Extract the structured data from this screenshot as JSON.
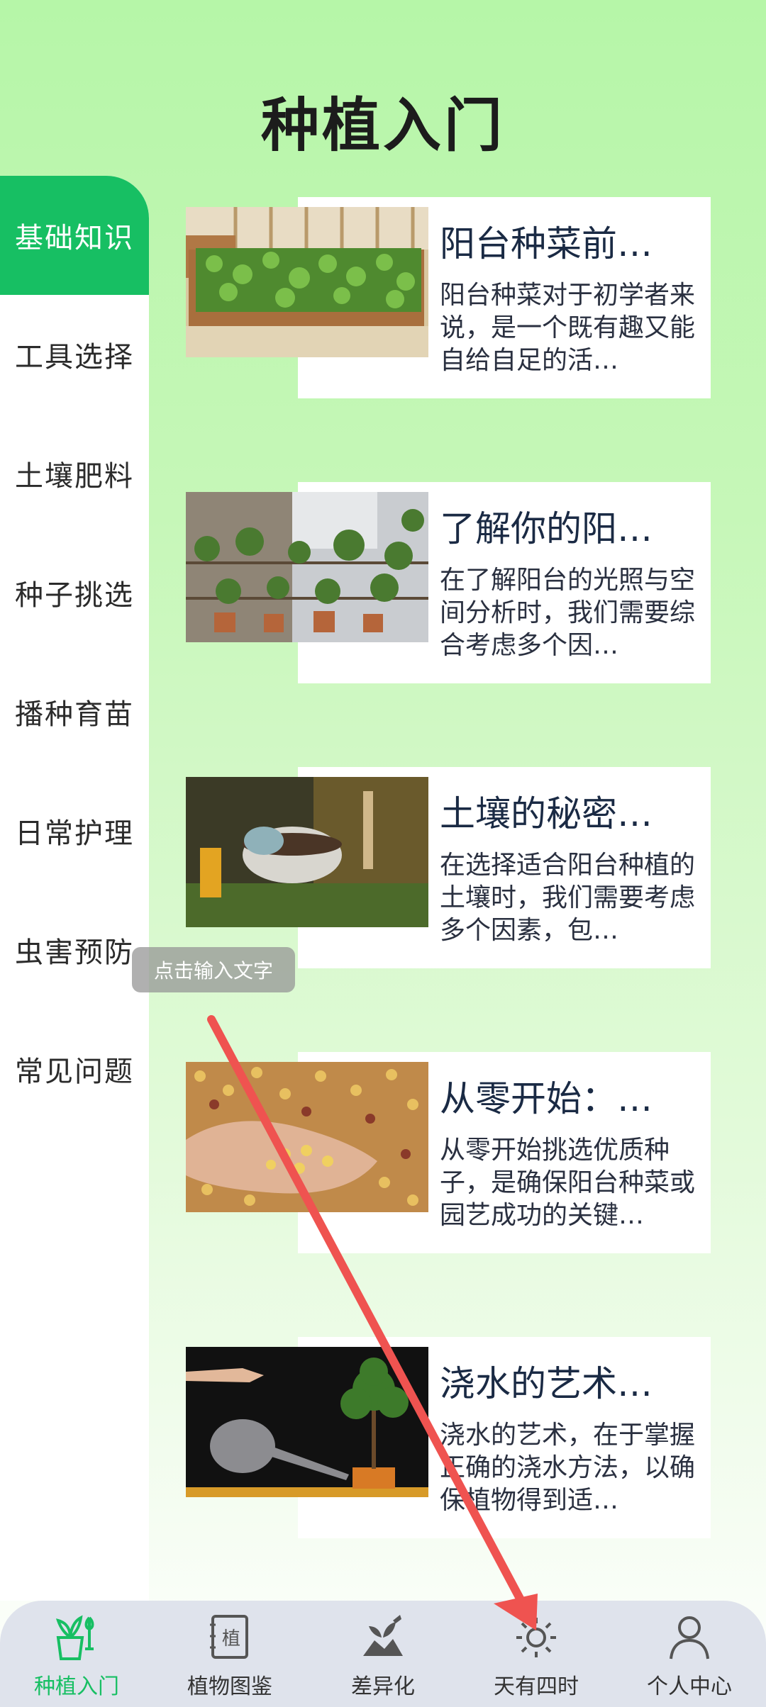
{
  "page": {
    "title": "种植入门"
  },
  "sidebar": {
    "items": [
      {
        "label": "基础知识",
        "active": true
      },
      {
        "label": "工具选择",
        "active": false
      },
      {
        "label": "土壤肥料",
        "active": false
      },
      {
        "label": "种子挑选",
        "active": false
      },
      {
        "label": "播种育苗",
        "active": false
      },
      {
        "label": "日常护理",
        "active": false
      },
      {
        "label": "虫害预防",
        "active": false
      },
      {
        "label": "常见问题",
        "active": false
      }
    ]
  },
  "articles": [
    {
      "title": "阳台种菜前…",
      "desc": "阳台种菜对于初学者来说，是一个既有趣又能自给自足的活…"
    },
    {
      "title": "了解你的阳…",
      "desc": "在了解阳台的光照与空间分析时，我们需要综合考虑多个因…"
    },
    {
      "title": "土壤的秘密…",
      "desc": "在选择适合阳台种植的土壤时，我们需要考虑多个因素，包…"
    },
    {
      "title": "从零开始：…",
      "desc": "从零开始挑选优质种子，是确保阳台种菜或园艺成功的关键…"
    },
    {
      "title": "浇水的艺术…",
      "desc": "浇水的艺术，在于掌握正确的浇水方法，以确保植物得到适…"
    }
  ],
  "tooltip": {
    "text": "点击输入文字"
  },
  "tabbar": {
    "items": [
      {
        "label": "种植入门",
        "icon": "planting-icon",
        "active": true
      },
      {
        "label": "植物图鉴",
        "icon": "plant-book-icon",
        "active": false
      },
      {
        "label": "差异化",
        "icon": "differentiation-icon",
        "active": false
      },
      {
        "label": "天有四时",
        "icon": "sun-icon",
        "active": false
      },
      {
        "label": "个人中心",
        "icon": "person-icon",
        "active": false
      }
    ],
    "icon_glyph": "植"
  },
  "colors": {
    "accent": "#17bf63",
    "arrow": "#ef5350"
  }
}
